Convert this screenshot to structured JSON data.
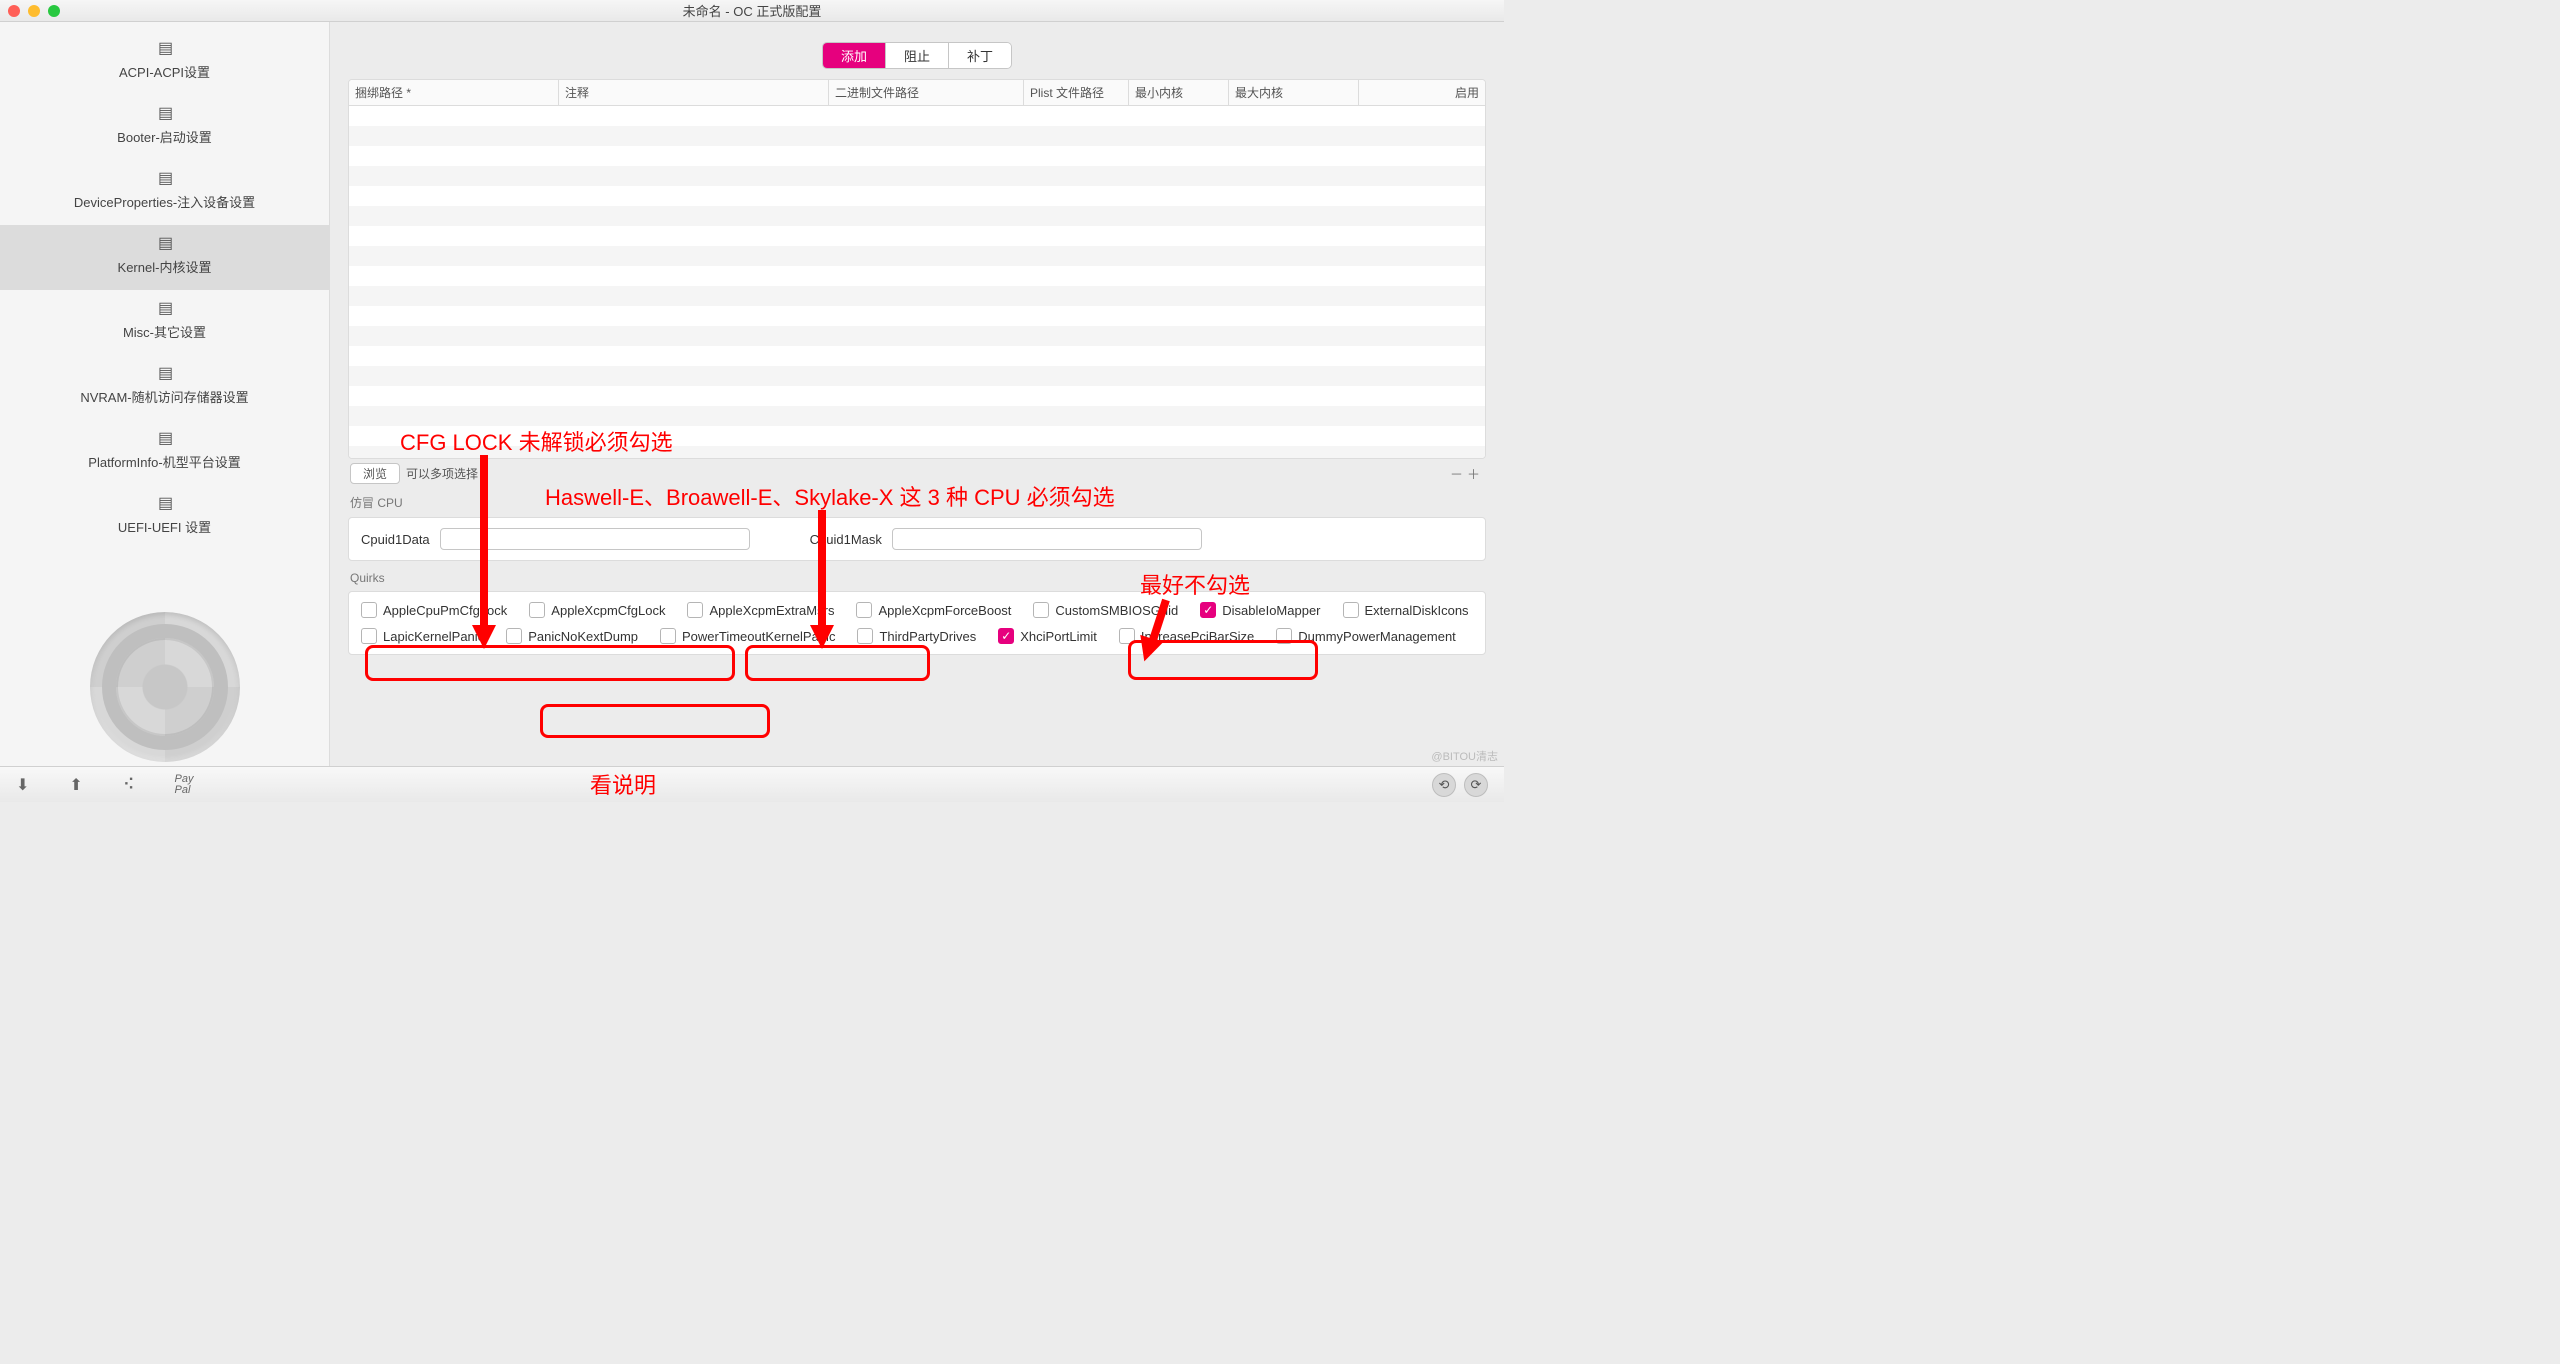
{
  "window": {
    "title": "未命名 - OC 正式版配置"
  },
  "sidebar": {
    "items": [
      {
        "label": "ACPI-ACPI设置"
      },
      {
        "label": "Booter-启动设置"
      },
      {
        "label": "DeviceProperties-注入设备设置"
      },
      {
        "label": "Kernel-内核设置"
      },
      {
        "label": "Misc-其它设置"
      },
      {
        "label": "NVRAM-随机访问存储器设置"
      },
      {
        "label": "PlatformInfo-机型平台设置"
      },
      {
        "label": "UEFI-UEFI 设置"
      }
    ]
  },
  "tabs": {
    "add": "添加",
    "block": "阻止",
    "patch": "补丁"
  },
  "table": {
    "headers": {
      "bundle": "捆绑路径 *",
      "comment": "注释",
      "exec": "二进制文件路径",
      "plist": "Plist 文件路径",
      "minkernel": "最小内核",
      "maxkernel": "最大内核",
      "enabled": "启用"
    }
  },
  "under_table": {
    "browse": "浏览",
    "multiselect": "可以多项选择",
    "plusminus": "－＋"
  },
  "emulate": {
    "group": "仿冒 CPU",
    "cpuid1data": "Cpuid1Data",
    "cpuid1mask": "Cpuid1Mask"
  },
  "quirks": {
    "group": "Quirks",
    "items": {
      "AppleCpuPmCfgLock": "AppleCpuPmCfgLock",
      "AppleXcpmCfgLock": "AppleXcpmCfgLock",
      "AppleXcpmExtraMsrs": "AppleXcpmExtraMsrs",
      "AppleXcpmForceBoost": "AppleXcpmForceBoost",
      "CustomSMBIOSGuid": "CustomSMBIOSGuid",
      "DisableIoMapper": "DisableIoMapper",
      "ExternalDiskIcons": "ExternalDiskIcons",
      "LapicKernelPanic": "LapicKernelPanic",
      "PanicNoKextDump": "PanicNoKextDump",
      "PowerTimeoutKernelPanic": "PowerTimeoutKernelPanic",
      "ThirdPartyDrives": "ThirdPartyDrives",
      "XhciPortLimit": "XhciPortLimit",
      "IncreasePciBarSize": "IncreasePciBarSize",
      "DummyPowerManagement": "DummyPowerManagement"
    }
  },
  "bottombar": {
    "paypal": "Pay\nPal"
  },
  "annotations": {
    "cfg_lock": "CFG LOCK 未解锁必须勾选",
    "haswell": "Haswell-E、Broawell-E、Skylake-X 这 3 种 CPU 必须勾选",
    "no_check": "最好不勾选",
    "see_desc": "看说明"
  },
  "watermark": "@BITOU清志"
}
